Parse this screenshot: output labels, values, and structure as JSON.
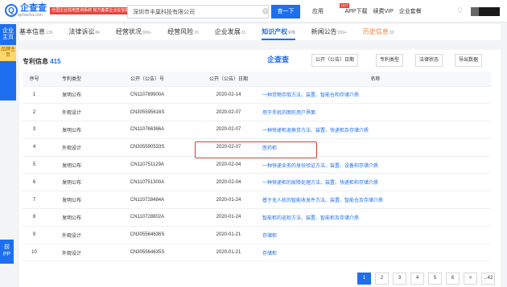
{
  "header": {
    "brand": "企查查",
    "brand_url": "qichacha.com",
    "brand_tag": "全国企业信用查询系统\n官方备案企业征信机构",
    "search": {
      "value": "深圳市丰巢科技有限公司",
      "button": "查一下"
    },
    "nav": [
      "应用",
      "APP下载",
      "续费VIP",
      "企业套餐"
    ],
    "hot": "HOT"
  },
  "side": {
    "main": "企业主页",
    "sub": "品牌主页",
    "tip": "前\nPP"
  },
  "tabs": [
    {
      "label": "基本信息",
      "count": "139"
    },
    {
      "label": "法律诉讼",
      "count": "84"
    },
    {
      "label": "经营状况",
      "count": "999+"
    },
    {
      "label": "经营风险",
      "count": "20"
    },
    {
      "label": "企业发展",
      "count": "31"
    },
    {
      "label": "知识产权",
      "count": "678"
    },
    {
      "label": "新闻公告",
      "count": "999+"
    },
    {
      "label": "历史信息",
      "count": "32"
    }
  ],
  "panel": {
    "title": "专利信息",
    "count": "415",
    "brand": "企查查",
    "filters": [
      "公开（公告）日期",
      "专利类型",
      "法律状态",
      "导出数据"
    ]
  },
  "table": {
    "headers": [
      "序号",
      "专利类型",
      "公开（公告）号",
      "公开（公告）日期",
      "名称"
    ],
    "rows": [
      [
        "1",
        "发明公布",
        "CN110789900A",
        "2020-02-14",
        "一种货物存取方法、装置、智能仓和存储介质"
      ],
      [
        "2",
        "外观设计",
        "CN305595616S",
        "2020-02-07",
        "用于手机的图形用户界面"
      ],
      [
        "3",
        "发明公布",
        "CN110766366A",
        "2020-02-07",
        "一种快递柜退换货方法、装置、快递柜及存储介质"
      ],
      [
        "4",
        "外观设计",
        "CN305590533S",
        "2020-02-07",
        "医药柜"
      ],
      [
        "5",
        "发明公布",
        "CN110751129A",
        "2020-02-04",
        "一种快递业务的身份验证方法、装置、设备和存储介质"
      ],
      [
        "6",
        "发明公布",
        "CN110751300A",
        "2020-02-04",
        "一种快递柜的故障处理方法、装置、快递柜和存储介质"
      ],
      [
        "7",
        "发明公布",
        "CN110728484A",
        "2020-01-24",
        "基于无人机的智能收发件方法、装置、智能仓及存储介质"
      ],
      [
        "8",
        "发明公布",
        "CN110728802A",
        "2020-01-24",
        "智能柜的巡检方法、装置、智能柜及存储介质"
      ],
      [
        "9",
        "外观设计",
        "CN305564636S",
        "2020-01-21",
        "存储柜"
      ],
      [
        "10",
        "外观设计",
        "CN305564635S",
        "2020-01-21",
        "存储柜"
      ]
    ]
  },
  "pagination": [
    "1",
    "2",
    "3",
    "4",
    "5",
    "6",
    ">",
    "...42"
  ]
}
